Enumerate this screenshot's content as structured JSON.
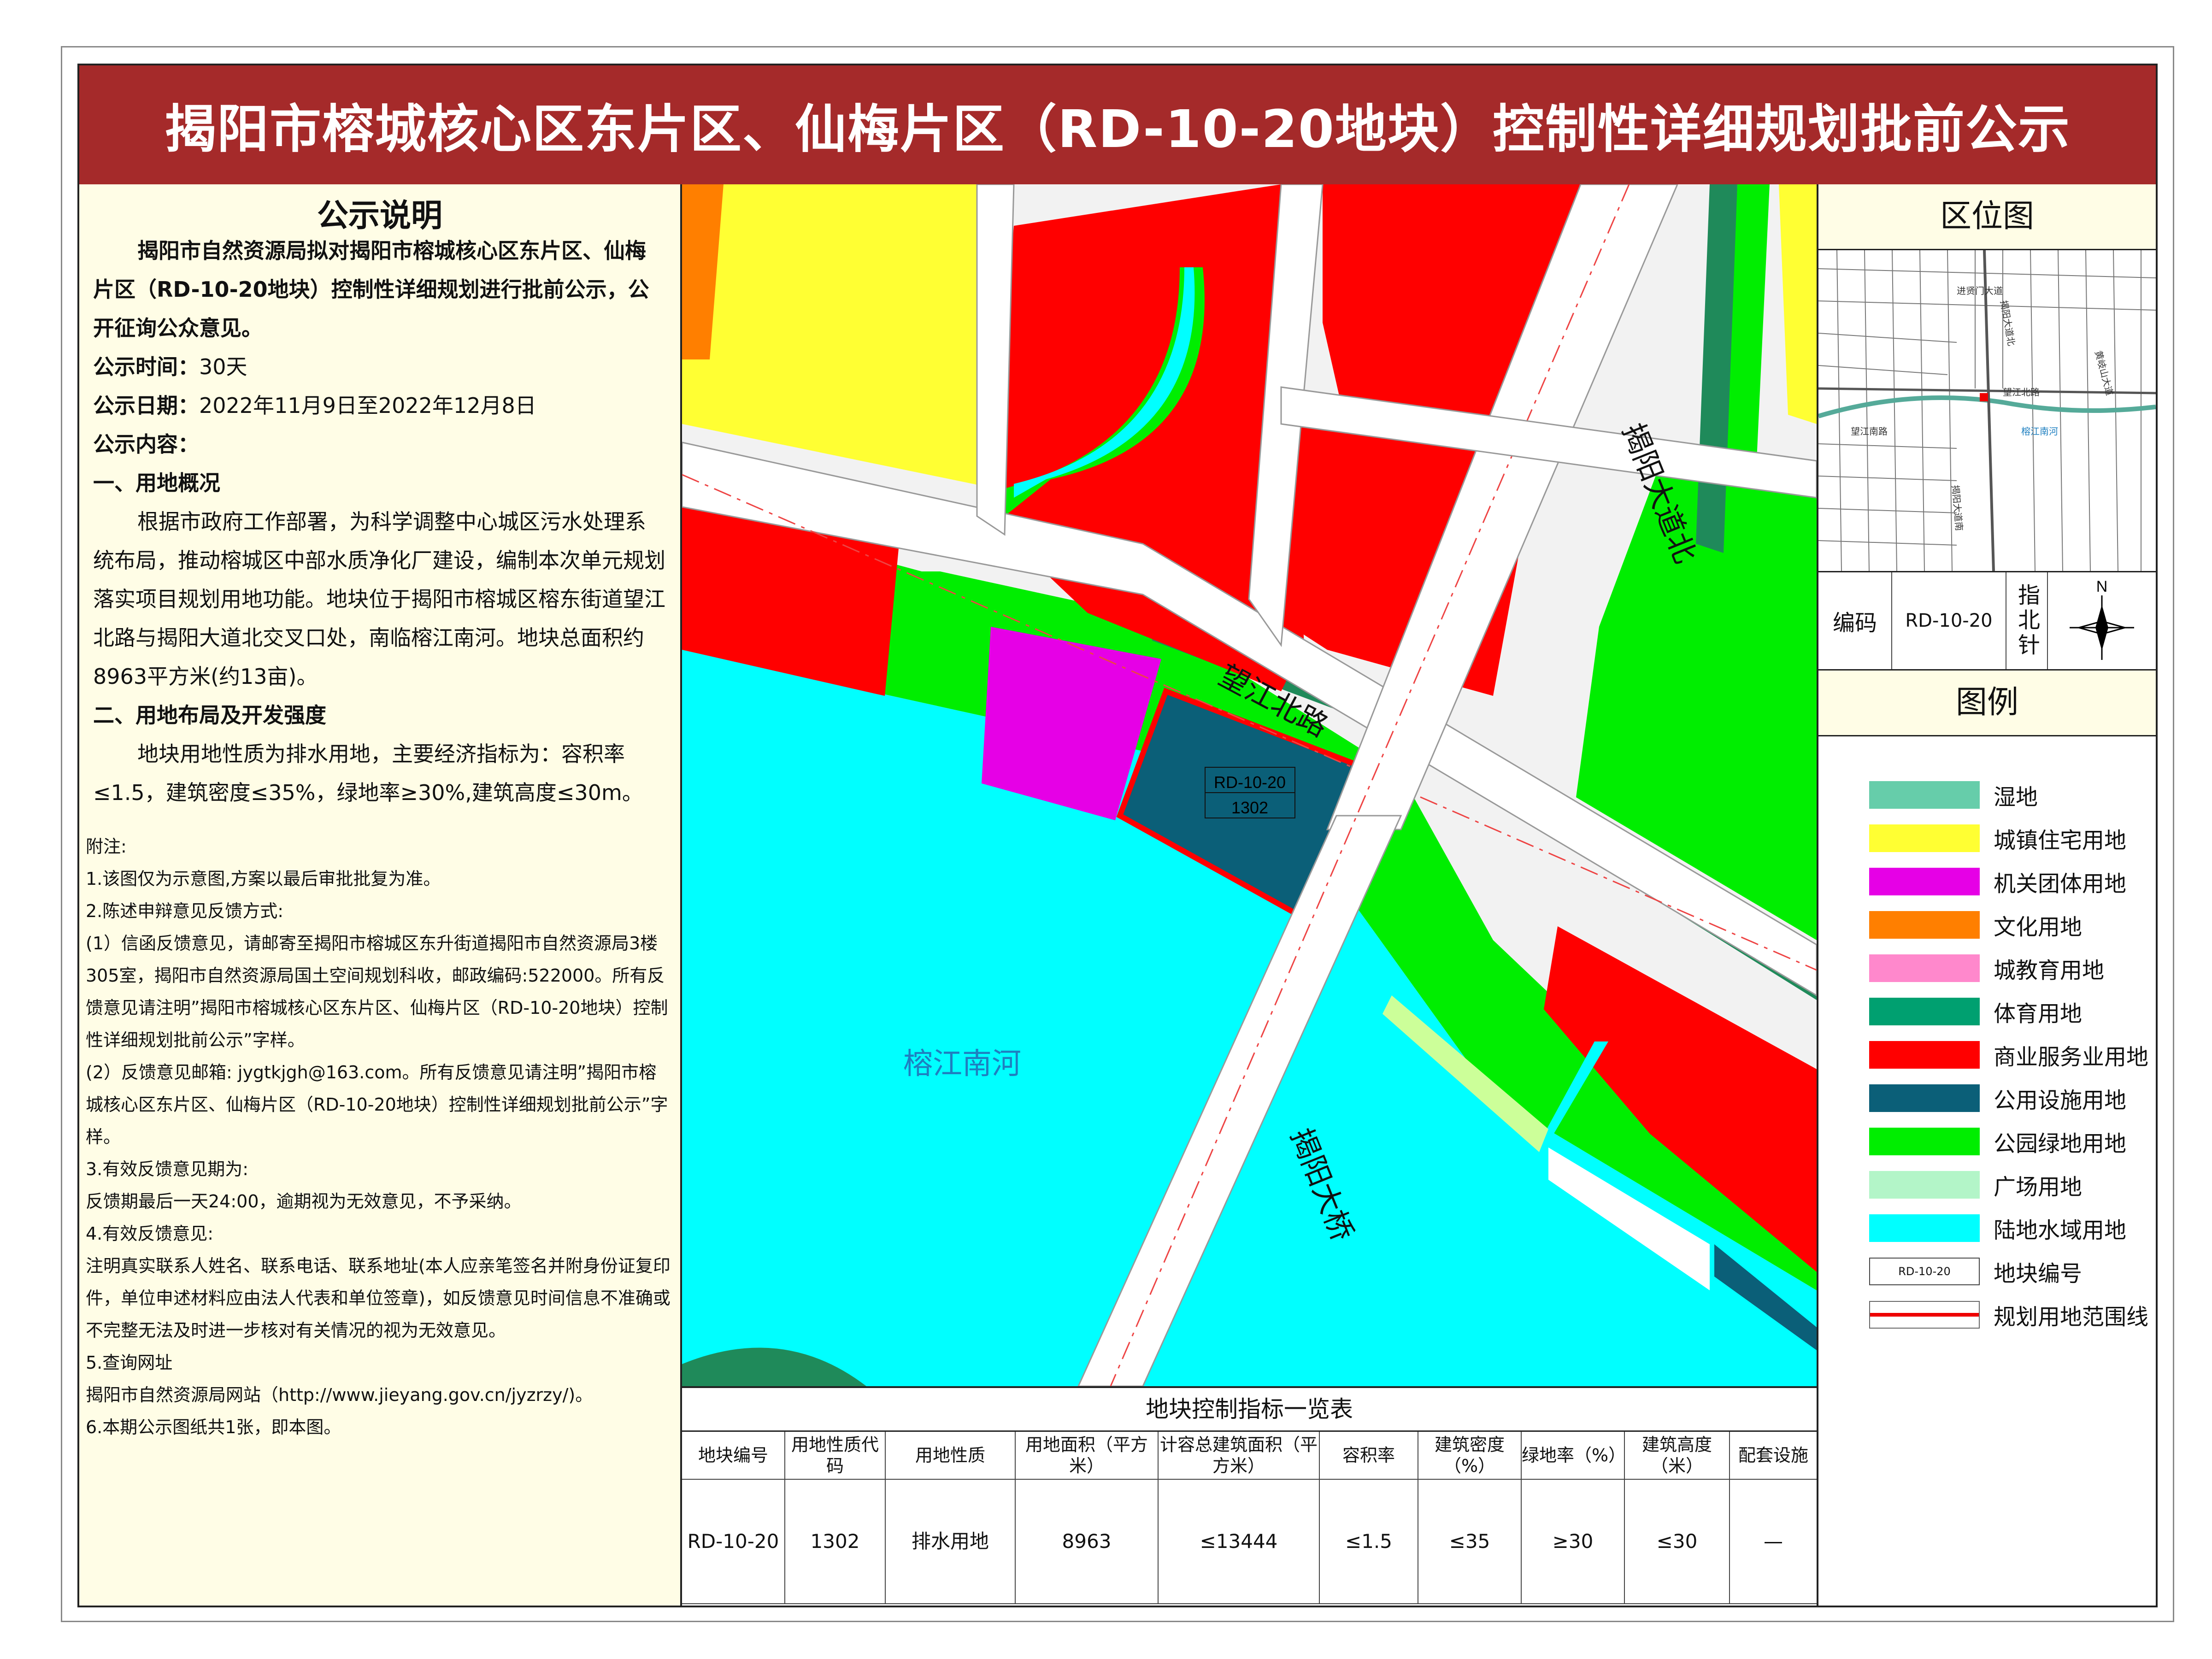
{
  "title": "揭阳市榕城核心区东片区、仙梅片区（RD-10-20地块）控制性详细规划批前公示",
  "notice": {
    "heading": "公示说明",
    "intro_bold": "揭阳市自然资源局拟对揭阳市榕城核心区东片区、仙梅片区（RD-10-20地块）控制性详细规划进行批前公示，公开征询公众意见。",
    "time_label": "公示时间：",
    "time_value": "30天",
    "date_label": "公示日期：",
    "date_value": "2022年11月9日至2022年12月8日",
    "content_label": "公示内容：",
    "section1_title": "一、用地概况",
    "section1_text": "根据市政府工作部署，为科学调整中心城区污水处理系统布局，推动榕城区中部水质净化厂建设，编制本次单元规划落实项目规划用地功能。地块位于揭阳市榕城区榕东街道望江北路与揭阳大道北交叉口处，南临榕江南河。地块总面积约8963平方米(约13亩)。",
    "section2_title": "二、用地布局及开发强度",
    "section2_text": "地块用地性质为排水用地，主要经济指标为：容积率≤1.5，建筑密度≤35%，绿地率≥30%,建筑高度≤30m。"
  },
  "notes": {
    "heading": "附注:",
    "items": [
      "1.该图仅为示意图,方案以最后审批批复为准。",
      "2.陈述申辩意见反馈方式:",
      "(1）信函反馈意见，请邮寄至揭阳市榕城区东升街道揭阳市自然资源局3楼305室，揭阳市自然资源局国土空间规划科收，邮政编码:522000。所有反馈意见请注明”揭阳市榕城核心区东片区、仙梅片区（RD-10-20地块）控制性详细规划批前公示”字样。",
      "(2）反馈意见邮箱: jygtkjgh@163.com。所有反馈意见请注明”揭阳市榕城核心区东片区、仙梅片区（RD-10-20地块）控制性详细规划批前公示”字样。",
      "3.有效反馈意见期为:",
      "反馈期最后一天24:00，逾期视为无效意见，不予采纳。",
      "4.有效反馈意见:",
      "注明真实联系人姓名、联系电话、联系地址(本人应亲笔签名并附身份证复印件，单位申述材料应由法人代表和单位签章)，如反馈意见时间信息不准确或不完整无法及时进一步核对有关情况的视为无效意见。",
      "5.查询网址",
      "揭阳市自然资源局网站（http://www.jieyang.gov.cn/jyzrzy/)。",
      "6.本期公示图纸共1张，即本图。"
    ]
  },
  "map": {
    "road_wangjiang": "望江北路",
    "road_dadao": "揭阳大道北",
    "bridge": "揭阳大桥",
    "river": "榕江南河",
    "parcel_code": "RD-10-20",
    "parcel_use_code": "1302"
  },
  "table": {
    "title": "地块控制指标一览表",
    "headers": [
      "地块编号",
      "用地性质代码",
      "用地性质",
      "用地面积（平方米）",
      "计容总建筑面积（平方米）",
      "容积率",
      "建筑密度（%）",
      "绿地率（%）",
      "建筑高度（米）",
      "配套设施"
    ],
    "row": [
      "RD-10-20",
      "1302",
      "排水用地",
      "8963",
      "≤13444",
      "≤1.5",
      "≤35",
      "≥30",
      "≤30",
      "—"
    ]
  },
  "location": {
    "heading": "区位图",
    "labels": [
      "进贤门大道",
      "揭阳大道北",
      "望江北路",
      "望江南路",
      "榕江南河",
      "揭阳大道南",
      "黄岐山大道"
    ],
    "code_label": "编码",
    "code_value": "RD-10-20",
    "north_label": "指北针",
    "north_letter": "N"
  },
  "legend": {
    "heading": "图例",
    "items": [
      {
        "label": "湿地",
        "color": "#66cdaa"
      },
      {
        "label": "城镇住宅用地",
        "color": "#ffff33"
      },
      {
        "label": "机关团体用地",
        "color": "#e600e6"
      },
      {
        "label": "文化用地",
        "color": "#ff7f00"
      },
      {
        "label": "城教育用地",
        "color": "#ff88cc"
      },
      {
        "label": "体育用地",
        "color": "#00a070"
      },
      {
        "label": "商业服务业用地",
        "color": "#ff0000"
      },
      {
        "label": "公用设施用地",
        "color": "#0b5f78"
      },
      {
        "label": "公园绿地用地",
        "color": "#00ee00"
      },
      {
        "label": "广场用地",
        "color": "#b3f5c8"
      },
      {
        "label": "陆地水域用地",
        "color": "#00ffff"
      }
    ],
    "code_item": {
      "label": "地块编号",
      "sample": "RD-10-20"
    },
    "line_item": {
      "label": "规划用地范围线"
    }
  }
}
